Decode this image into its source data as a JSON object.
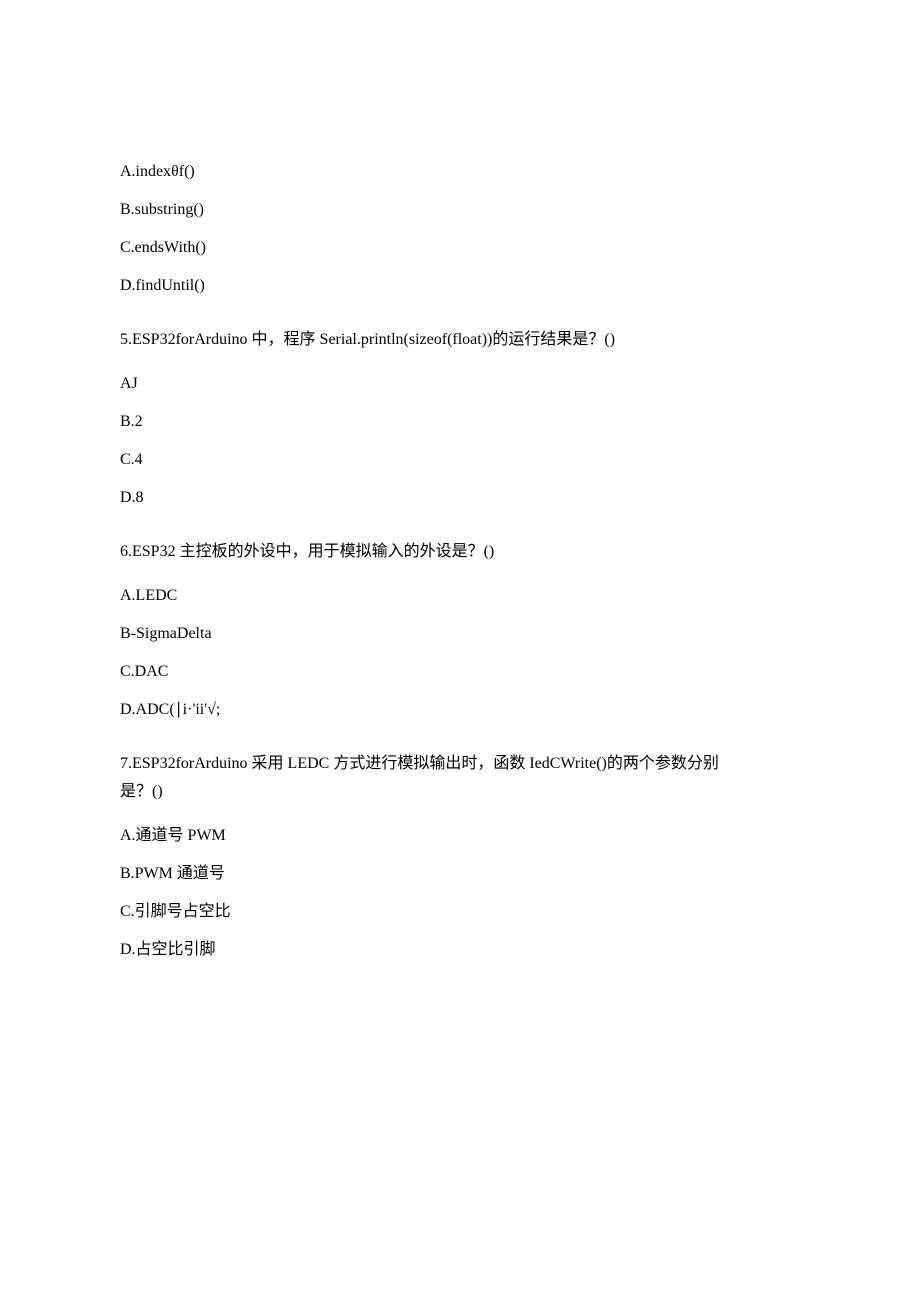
{
  "q4_options": {
    "a": "A.indexθf()",
    "b": "B.substring()",
    "c": "C.endsWith()",
    "d": "D.findUntil()"
  },
  "q5": {
    "text": "5.ESP32forArduino 中，程序 Serial.println(sizeof(float))的运行结果是？()",
    "options": {
      "a": "AJ",
      "b": "B.2",
      "c": "C.4",
      "d": "D.8"
    }
  },
  "q6": {
    "text": "6.ESP32 主控板的外设中，用于模拟输入的外设是？()",
    "options": {
      "a": "A.LEDC",
      "b": "B-SigmaDelta",
      "c": "C.DAC",
      "d": "D.ADC(∣i·'ii'√;"
    }
  },
  "q7": {
    "text1": "7.ESP32forArduino 采用 LEDC 方式进行模拟输出时，函数 IedCWrite()的两个参数分别",
    "text2": "是？()",
    "options": {
      "a": "A.通道号 PWM",
      "b": "B.PWM 通道号",
      "c": "C.引脚号占空比",
      "d": "D.占空比引脚"
    }
  }
}
